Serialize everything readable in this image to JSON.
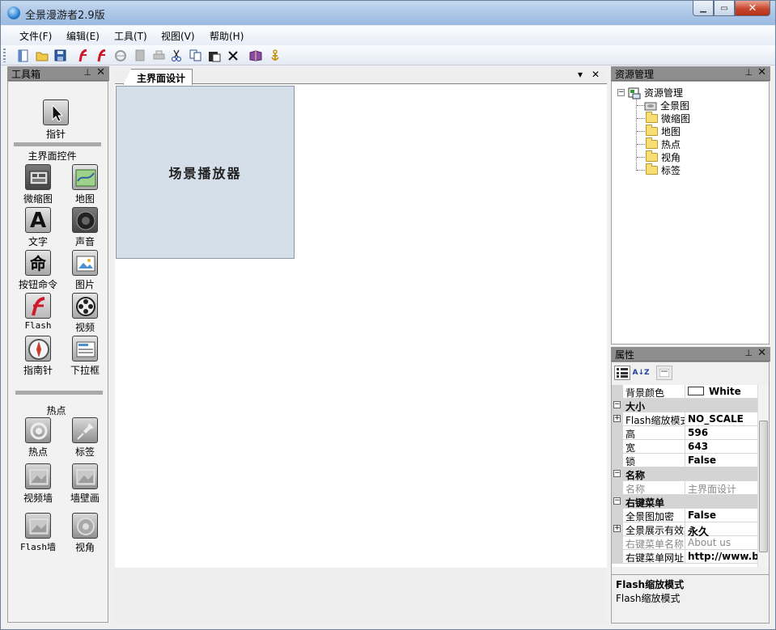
{
  "window": {
    "title": "全景漫游者2.9版"
  },
  "menu": [
    "文件(F)",
    "编辑(E)",
    "工具(T)",
    "视图(V)",
    "帮助(H)"
  ],
  "toolbox": {
    "title": "工具箱",
    "pointer": "指针",
    "section_main": "主界面控件",
    "main_tools": [
      "微缩图",
      "地图",
      "文字",
      "声音",
      "按钮命令",
      "图片",
      "Flash",
      "视频",
      "指南针",
      "下拉框"
    ],
    "section_hotspot": "热点",
    "hotspot_tools": [
      "热点",
      "标签",
      "视频墙",
      "墙壁画",
      "Flash墙",
      "视角"
    ],
    "text_glyph": "A",
    "command_glyph": "命"
  },
  "document": {
    "tab": "主界面设计",
    "player_label": "场景播放器"
  },
  "resources": {
    "title": "资源管理",
    "root": "资源管理",
    "items": [
      "全景图",
      "微缩图",
      "地图",
      "热点",
      "视角",
      "标签"
    ]
  },
  "properties": {
    "title": "属性",
    "rows": {
      "bgcolor": {
        "key": "背景颜色",
        "value": "White"
      },
      "cat_size": "大小",
      "flash_mode": {
        "key": "Flash缩放模式",
        "value": "NO_SCALE"
      },
      "height": {
        "key": "高",
        "value": "596"
      },
      "width": {
        "key": "宽",
        "value": "643"
      },
      "lock": {
        "key": "锁",
        "value": "False"
      },
      "cat_name": "名称",
      "name": {
        "key": "名称",
        "value": "主界面设计"
      },
      "cat_menu": "右键菜单",
      "encrypt": {
        "key": "全景图加密",
        "value": "False"
      },
      "valid": {
        "key": "全景展示有效期",
        "value": "永久"
      },
      "menu_name": {
        "key": "右键菜单名称",
        "value": "About us"
      },
      "menu_url": {
        "key": "右键菜单网址",
        "value": "http://www.byc"
      }
    },
    "description": {
      "title": "Flash缩放模式",
      "text": "Flash缩放模式"
    }
  }
}
